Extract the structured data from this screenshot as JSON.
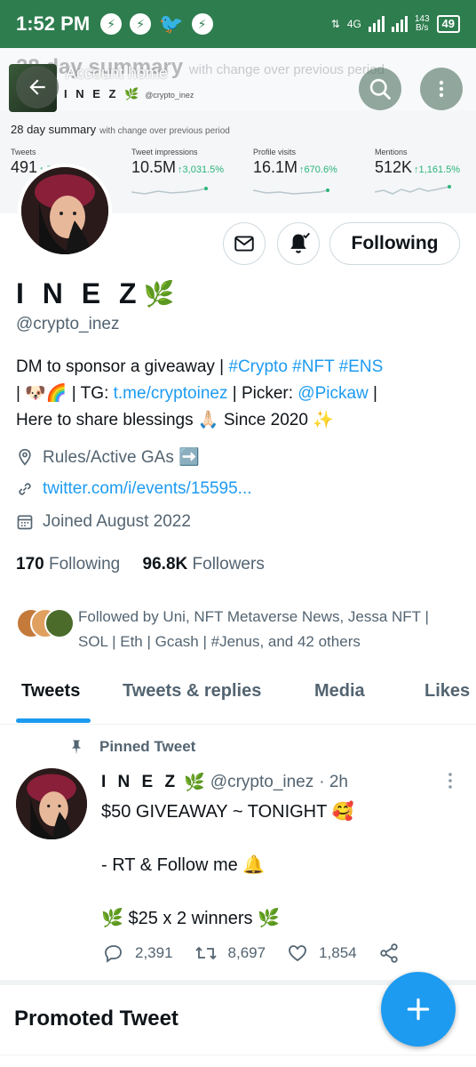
{
  "status_bar": {
    "time": "1:52 PM",
    "network": "4G",
    "speed_value": "143",
    "speed_unit": "B/s",
    "battery": "49"
  },
  "banner": {
    "ghost_title": "28 day summary",
    "ghost_sub": "with change over previous period",
    "back_label": "Account home",
    "brand_name": "I N E Z",
    "brand_handle": "@crypto_inez",
    "summary_title": "28 day summary",
    "summary_sub": "with change over previous period",
    "stats": [
      {
        "label": "Tweets",
        "value": "491",
        "change": "↑ 5.5%"
      },
      {
        "label": "Tweet impressions",
        "value": "10.5M",
        "change": "↑3,031.5%"
      },
      {
        "label": "Profile visits",
        "value": "16.1M",
        "change": "↑670.6%"
      },
      {
        "label": "Mentions",
        "value": "512K",
        "change": "↑1,161.5%"
      }
    ]
  },
  "profile": {
    "follow_button": "Following",
    "display_name": "I N E Z",
    "handle": "@crypto_inez",
    "bio_line1_text": "DM to sponsor a giveaway | ",
    "bio_line1_tags": "#Crypto #NFT #ENS",
    "bio_line2_a": "| 🐶🌈 | TG: ",
    "bio_line2_link": "t.me/cryptoinez",
    "bio_line2_b": " | Picker: ",
    "bio_line2_mention": "@Pickaw",
    "bio_line2_c": " |",
    "bio_line3": "Here to share blessings 🙏🏻 Since 2020 ✨",
    "location": "Rules/Active GAs ➡️",
    "website": "twitter.com/i/events/15595...",
    "joined": "Joined August 2022",
    "following_count": "170",
    "following_label": "Following",
    "followers_count": "96.8K",
    "followers_label": "Followers",
    "followed_by": "Followed by Uni, NFT Metaverse News, Jessa NFT | SOL | Eth | Gcash | #Jenus, and 42 others"
  },
  "tabs": [
    "Tweets",
    "Tweets & replies",
    "Media",
    "Likes"
  ],
  "tweet": {
    "pinned_label": "Pinned Tweet",
    "name": "I N E Z",
    "handle": "@crypto_inez",
    "time": "· 2h",
    "line1": "$50 GIVEAWAY ~ TONIGHT 🥰",
    "line2": "- RT & Follow me 🔔",
    "line3": "🌿 $25 x 2 winners 🌿",
    "replies": "2,391",
    "retweets": "8,697",
    "likes": "1,854"
  },
  "promoted": "Promoted Tweet",
  "colors": {
    "accent": "#1d9bf0",
    "status_bar": "#2e7d4f",
    "text_secondary": "#536471",
    "growth": "#2bb47a"
  }
}
